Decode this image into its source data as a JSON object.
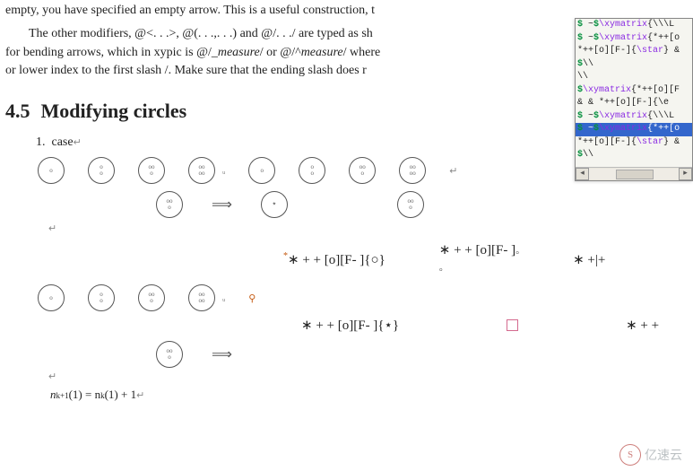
{
  "top": {
    "line1": "empty, you have specified an empty arrow. This is a useful construction, t",
    "line2a": "The other modifiers, @<. . .>, @(. . .,. . .) and @/. . ./ are typed as sh",
    "line2b": "for bending arrows, which in xypic is @/_",
    "line2c": "measure",
    "line2d": "/ or @/^",
    "line2e": "measure",
    "line2f": "/ where",
    "line3": "or lower index to the first slash /. Make sure that the ending slash does r"
  },
  "section": {
    "num": "4.5",
    "title": "Modifying circles"
  },
  "enum": {
    "item1": "case"
  },
  "formulas": {
    "r1a": "∗ + + [o][F- ]{○}",
    "r1b": "∗ + + [o][F- ]",
    "r1c": "∗ +|+",
    "r2a": "∗ + + [o][F- ]{⋆}",
    "r2c": "∗ + +"
  },
  "math": {
    "line1_pre": "n",
    "line1_sub1": "k+1",
    "line1_mid": "(1) = n",
    "line1_sub2": "k",
    "line1_post": "(1) + 1"
  },
  "panel": {
    "lines": [
      "$ ~$\\xymatrix{\\\\\\L",
      "$ ~$\\xymatrix{*++[o",
      "*++[o][F-]{\\star} &",
      "$\\\\",
      "\\\\",
      "$\\xymatrix{*++[o][F",
      "  &  & *++[o][F-]{\\e",
      "$ ~$\\xymatrix{\\\\\\L",
      "$ ~$\\xymatrix{*++[o",
      "*++[o][F-]{\\star} &",
      "$\\\\"
    ],
    "hlIndex": 8
  },
  "watermark": {
    "label": "亿速云",
    "badge": "S"
  }
}
